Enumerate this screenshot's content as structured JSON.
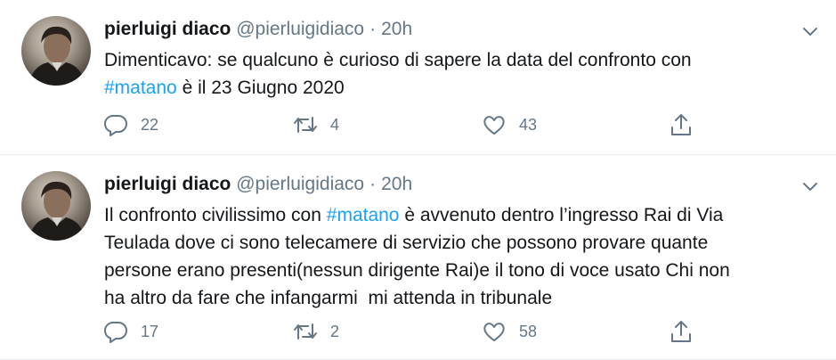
{
  "tweets": [
    {
      "author_name": "pierluigi diaco",
      "author_handle": "@pierluigidiaco",
      "separator": "·",
      "time": "20h",
      "text_before": "Dimenticavo: se qualcuno è curioso di sapere la data del confronto con\n",
      "hashtag": "#matano",
      "text_after": " è il 23 Giugno 2020",
      "replies": "22",
      "retweets": "4",
      "likes": "43"
    },
    {
      "author_name": "pierluigi diaco",
      "author_handle": "@pierluigidiaco",
      "separator": "·",
      "time": "20h",
      "text_before": "Il confronto civilissimo con ",
      "hashtag": "#matano",
      "text_after": " è avvenuto dentro l’ingresso Rai di Via\nTeulada dove ci sono telecamere di servizio che possono provare quante\npersone erano presenti(nessun dirigente Rai)e il tono di voce usato Chi non\nha altro da fare che infangarmi  mi attenda in tribunale",
      "replies": "17",
      "retweets": "2",
      "likes": "58"
    }
  ],
  "icons": {
    "reply": "reply-icon",
    "retweet": "retweet-icon",
    "like": "heart-icon",
    "share": "share-icon",
    "menu": "chevron-down-icon"
  },
  "colors": {
    "text": "#14171a",
    "secondary": "#657786",
    "link": "#1da1f2",
    "divider": "#e6ecf0"
  }
}
